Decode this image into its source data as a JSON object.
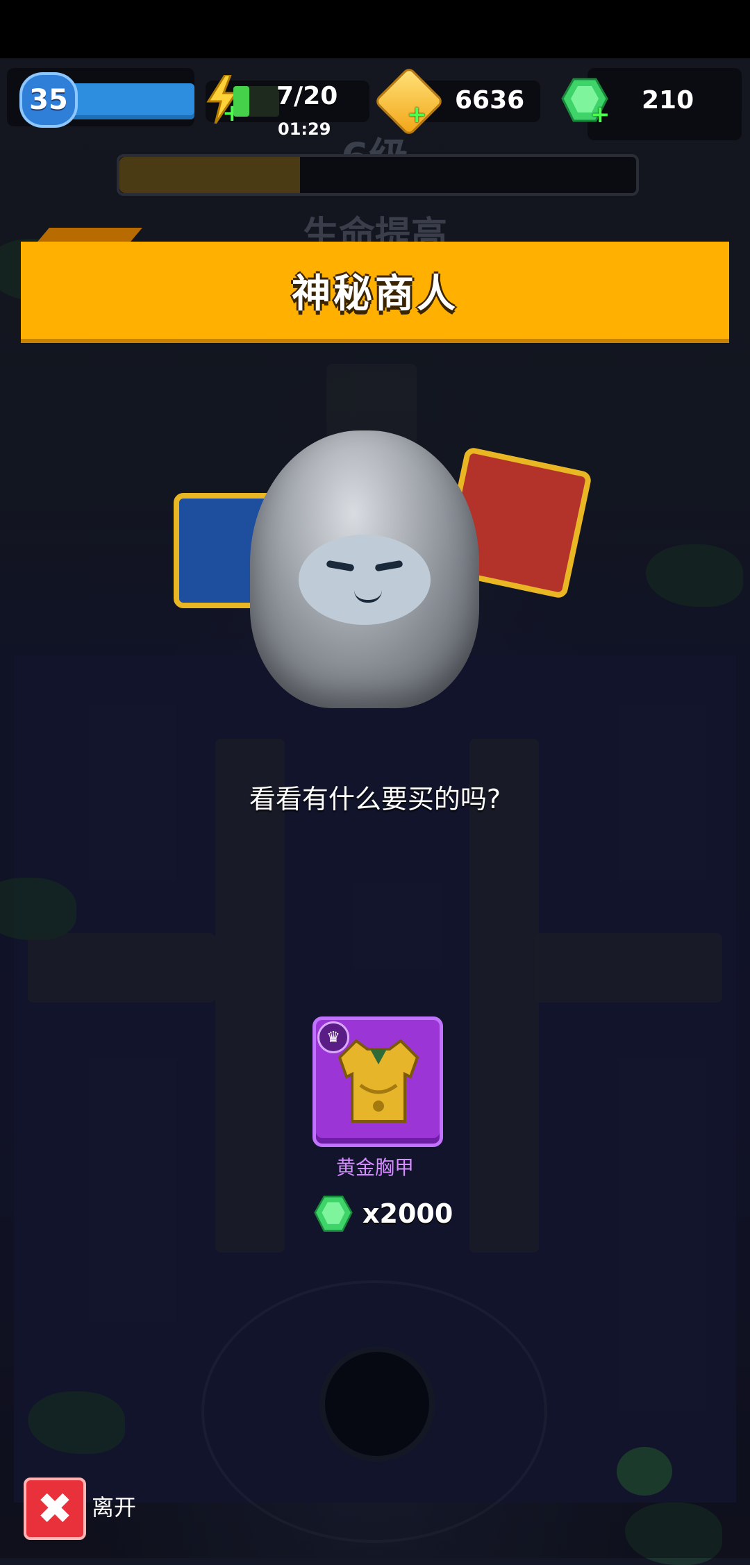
{
  "hud": {
    "player_level": "35",
    "energy": "7/20",
    "energy_fill": 0.35,
    "energy_timer": "01:29",
    "gold": "6636",
    "gems": "210"
  },
  "stage": {
    "level_label": "6级",
    "progress_fill": 0.35,
    "hint": "生命提高"
  },
  "merchant": {
    "title": "神秘商人",
    "dialog": "看看有什么要买的吗?"
  },
  "offer": {
    "item_name": "黄金胸甲",
    "price": "x2000",
    "currency_icon": "green-gem-icon",
    "rarity_color": "#9b35d6"
  },
  "footer": {
    "leave_label": "离开"
  },
  "colors": {
    "banner": "#ffb000",
    "leave_button": "#e8313a",
    "gem": "#3ed46a",
    "energy": "#45d24a"
  }
}
